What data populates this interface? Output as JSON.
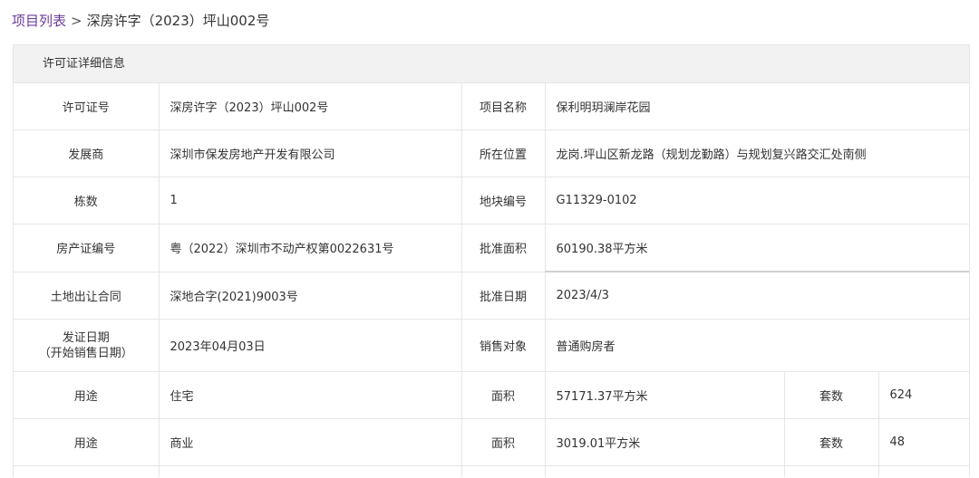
{
  "breadcrumb": {
    "link": "项目列表",
    "separator": ">",
    "current": "深房许字（2023）坪山002号"
  },
  "panel": {
    "title": "许可证详细信息"
  },
  "details": {
    "permit_no_label": "许可证号",
    "permit_no": "深房许字（2023）坪山002号",
    "project_name_label": "项目名称",
    "project_name": "保利明玥澜岸花园",
    "developer_label": "发展商",
    "developer": "深圳市保发房地产开发有限公司",
    "location_label": "所在位置",
    "location": "龙岗.坪山区新龙路（规划龙勤路）与规划复兴路交汇处南侧",
    "buildings_label": "栋数",
    "buildings": "1",
    "plot_no_label": "地块编号",
    "plot_no": "G11329-0102",
    "property_cert_label": "房产证编号",
    "property_cert": "粤（2022）深圳市不动产权第0022631号",
    "approved_area_label": "批准面积",
    "approved_area": "60190.38平方米",
    "land_contract_label": "土地出让合同",
    "land_contract": "深地合字(2021)9003号",
    "approval_date_label": "批准日期",
    "approval_date": "2023/4/3",
    "issue_date_label_1": "发证日期",
    "issue_date_label_2": "（开始销售日期）",
    "issue_date": "2023年04月03日",
    "sales_target_label": "销售对象",
    "sales_target": "普通购房者"
  },
  "usage_rows": [
    {
      "use_label": "用途",
      "use": "住宅",
      "area_label": "面积",
      "area": "57171.37平方米",
      "units_label": "套数",
      "units": "624"
    },
    {
      "use_label": "用途",
      "use": "商业",
      "area_label": "面积",
      "area": "3019.01平方米",
      "units_label": "套数",
      "units": "48"
    }
  ]
}
